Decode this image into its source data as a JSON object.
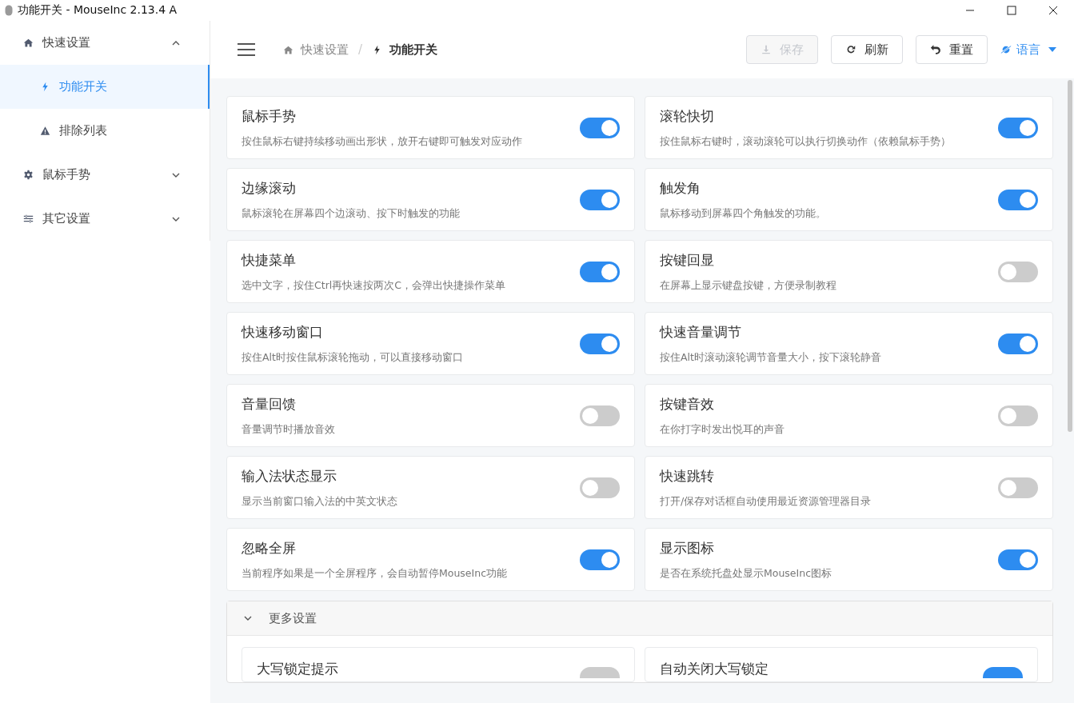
{
  "window": {
    "title": "功能开关 - MouseInc 2.13.4 A"
  },
  "sidebar": {
    "items": [
      {
        "label": "快速设置",
        "expanded": true,
        "selected": false,
        "children": [
          {
            "label": "功能开关",
            "selected": true
          },
          {
            "label": "排除列表",
            "selected": false
          }
        ]
      },
      {
        "label": "鼠标手势",
        "expanded": false,
        "selected": false
      },
      {
        "label": "其它设置",
        "expanded": false,
        "selected": false
      }
    ]
  },
  "breadcrumb": {
    "separator": "/",
    "items": [
      "快速设置",
      "功能开关"
    ]
  },
  "toolbar": {
    "buttons": [
      {
        "label": "保存",
        "disabled": true
      },
      {
        "label": "刷新",
        "disabled": false
      },
      {
        "label": "重置",
        "disabled": false
      }
    ],
    "language": "语言"
  },
  "features": [
    {
      "title": "鼠标手势",
      "description": "按住鼠标右键持续移动画出形状，放开右键即可触发对应动作",
      "on": true
    },
    {
      "title": "滚轮快切",
      "description": "按住鼠标右键时，滚动滚轮可以执行切换动作（依赖鼠标手势）",
      "on": true
    },
    {
      "title": "边缘滚动",
      "description": "鼠标滚轮在屏幕四个边滚动、按下时触发的功能",
      "on": true
    },
    {
      "title": "触发角",
      "description": "鼠标移动到屏幕四个角触发的功能。",
      "on": true
    },
    {
      "title": "快捷菜单",
      "description": "选中文字，按住Ctrl再快速按两次C，会弹出快捷操作菜单",
      "on": true
    },
    {
      "title": "按键回显",
      "description": "在屏幕上显示键盘按键，方便录制教程",
      "on": false
    },
    {
      "title": "快速移动窗口",
      "description": "按住Alt时按住鼠标滚轮拖动，可以直接移动窗口",
      "on": true
    },
    {
      "title": "快速音量调节",
      "description": "按住Alt时滚动滚轮调节音量大小，按下滚轮静音",
      "on": true
    },
    {
      "title": "音量回馈",
      "description": "音量调节时播放音效",
      "on": false
    },
    {
      "title": "按键音效",
      "description": "在你打字时发出悦耳的声音",
      "on": false
    },
    {
      "title": "输入法状态显示",
      "description": "显示当前窗口输入法的中英文状态",
      "on": false
    },
    {
      "title": "快速跳转",
      "description": "打开/保存对话框自动使用最近资源管理器目录",
      "on": false
    },
    {
      "title": "忽略全屏",
      "description": "当前程序如果是一个全屏程序，会自动暂停MouseInc功能",
      "on": true
    },
    {
      "title": "显示图标",
      "description": "是否在系统托盘处显示MouseInc图标",
      "on": true
    }
  ],
  "more_settings": {
    "title": "更多设置",
    "expanded": true,
    "items": [
      {
        "title": "大写锁定提示",
        "on": false
      },
      {
        "title": "自动关闭大写锁定",
        "on": true
      }
    ]
  }
}
